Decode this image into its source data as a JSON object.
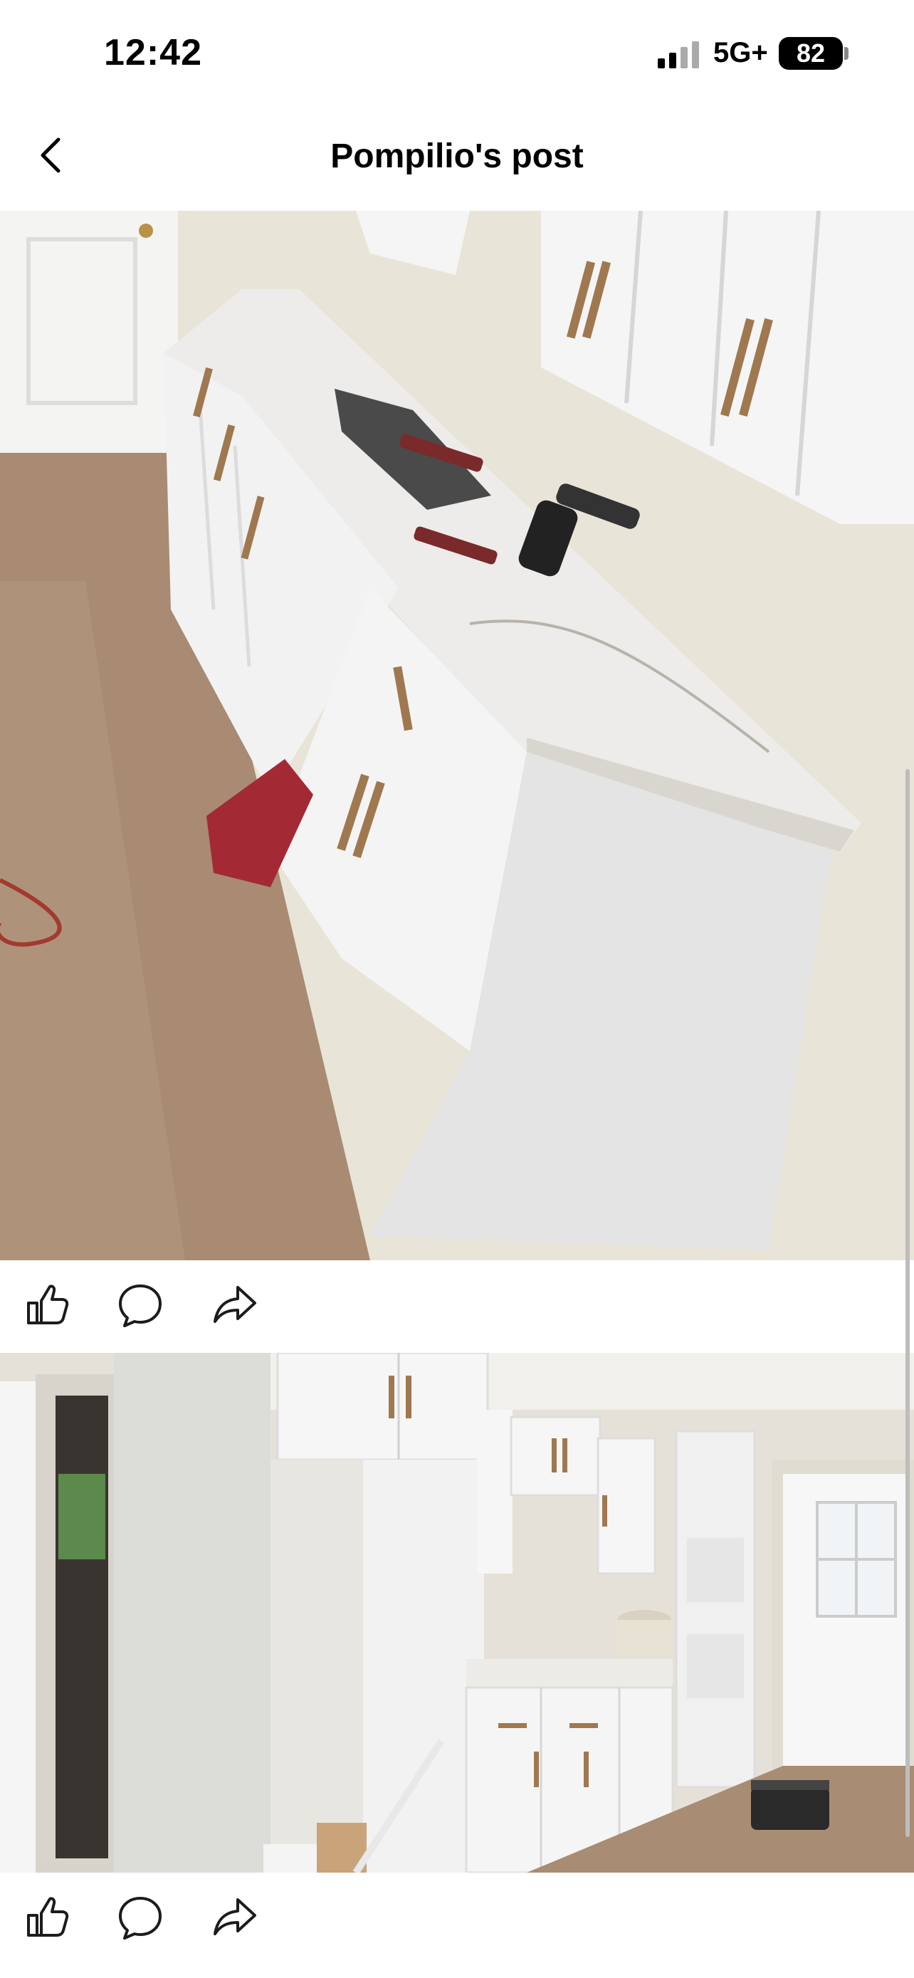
{
  "status": {
    "time": "12:42",
    "network": "5G+",
    "battery": "82"
  },
  "nav": {
    "title": "Pompilio's post"
  },
  "posts": [
    {
      "photo_icon": "kitchen-photo-counter",
      "actions": [
        "like-icon",
        "comment-icon",
        "share-icon"
      ]
    },
    {
      "photo_icon": "kitchen-photo-wide",
      "actions": [
        "like-icon",
        "comment-icon",
        "share-icon"
      ]
    }
  ],
  "colors": {
    "cabinet": "#f2f2f2",
    "counter": "#eceae6",
    "floor": "#a88c73",
    "wall": "#e8e2d4",
    "hardware": "#a0784f"
  }
}
